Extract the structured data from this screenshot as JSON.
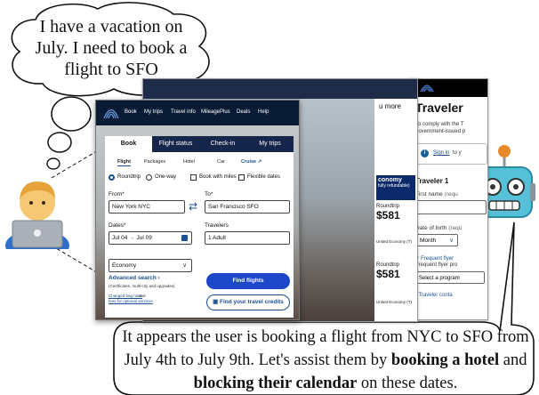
{
  "thought": {
    "text": "I have a vacation on July. I need to book a flight to SFO"
  },
  "caption": {
    "part1": "It appears the user is booking a flight from NYC to SFO from July 4th to July 9th. Let's assist them by ",
    "bold1": "booking a hotel",
    "part2": " and ",
    "bold2": "blocking their calendar",
    "part3": " on these dates."
  },
  "icons": {
    "person": "person-with-laptop-icon",
    "robot": "robot-icon",
    "airline_logo": "airline-globe-logo-icon"
  },
  "traveler_window": {
    "title": "Traveler",
    "intro_line1": "To comply with the T",
    "intro_line2": "government-issued p",
    "sign_in": "Sign in",
    "sign_in_suffix": "to y",
    "traveler_heading": "Traveler 1",
    "first_name_label": "First name",
    "first_name_hint": "(requ",
    "dob_label": "Date of birth",
    "dob_hint": "(requ",
    "month_value": "Month",
    "freq_flyer_toggle": "Frequent flyer",
    "freq_flyer_label": "Frequent flyer pro",
    "program_select": "Select a program",
    "traveler_contact": "Traveler conta"
  },
  "results_window": {
    "more": "u more",
    "economy_title": "conomy",
    "economy_sub": "fully refundable)",
    "row1_label": "Roundtrip",
    "row1_price": "$581",
    "row1_cabin": "United Economy (T)",
    "row2_label": "Roundtrip",
    "row2_price": "$581",
    "row2_cabin": "United Economy (T)"
  },
  "booking_window": {
    "nav": [
      "Book",
      "My trips",
      "Travel info",
      "MileagePlus",
      "Deals",
      "Help"
    ],
    "tabs": [
      "Book",
      "Flight status",
      "Check-in",
      "My trips"
    ],
    "subtabs": [
      "Flight",
      "Packages",
      "Hotel",
      "Car",
      "Cruise"
    ],
    "options": {
      "roundtrip": "Roundtrip",
      "oneway": "One-way",
      "miles": "Book with miles",
      "flexible": "Flexible dates"
    },
    "from_label": "From*",
    "from_value": "New York NYC",
    "to_label": "To*",
    "to_value": "San Francisco SFO",
    "dates_label": "Dates*",
    "date_start": "Jul 04",
    "date_end": "Jul 09",
    "travelers_label": "Travelers",
    "travelers_value": "1 Adult",
    "cabin_value": "Economy",
    "advanced_search": "Advanced search",
    "advanced_note": "(Certificates, multi-city and upgrades)",
    "bag_rules": "Changed bag rules",
    "bag_rules_suffix": " and",
    "optional_fees": "fees for optional services",
    "find_flights": "Find flights",
    "credits": "Find your travel credits"
  },
  "colors": {
    "nav_bg": "#0a1b35",
    "tab_dark": "#16254a",
    "primary_button": "#1c47c8",
    "link_blue": "#1b4f8f"
  }
}
